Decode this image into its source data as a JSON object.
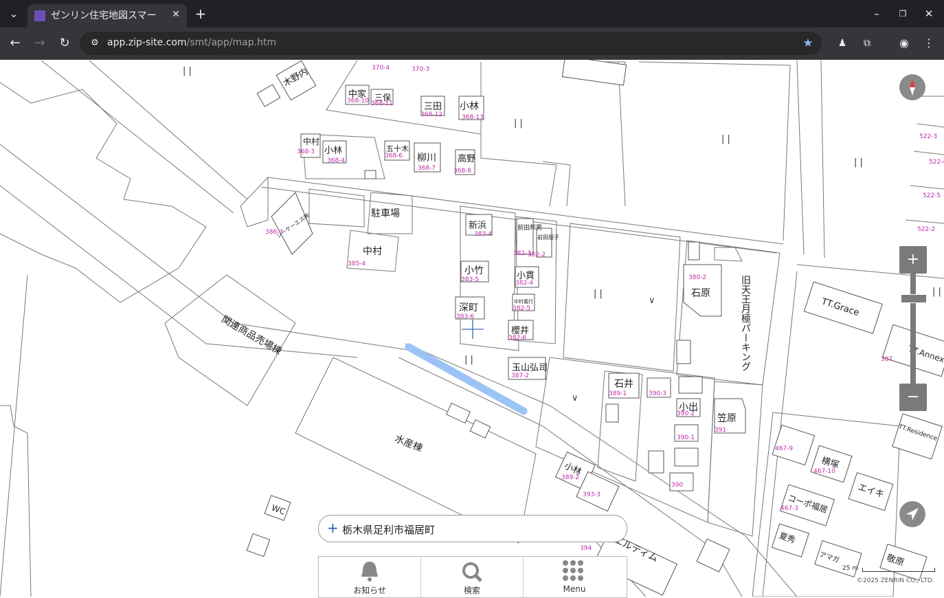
{
  "browser": {
    "tab_title": "ゼンリン住宅地図スマー",
    "url_host": "app.zip-site.com",
    "url_path": "/smt/app/map.htm"
  },
  "map": {
    "search_address": "栃木県足利市福居町",
    "menu": [
      {
        "label": "お知らせ",
        "icon": "bell-icon"
      },
      {
        "label": "検索",
        "icon": "search-icon"
      },
      {
        "label": "Menu",
        "icon": "grid-icon"
      }
    ],
    "zoom_in": "+",
    "zoom_out": "−",
    "scale_text": "25 m",
    "copyright": "©2025 ZENRIN CO., LTD.",
    "labels": {
      "kino": "木野内",
      "nakaya": "中家",
      "sanpo": "三保",
      "mita": "三田",
      "kobayashi1": "小林",
      "nakamura1": "中村",
      "kobayashi2": "小林",
      "isoju": "五十木",
      "yanagawa": "柳川",
      "takano": "高野",
      "parking": "駐車場",
      "shinhama": "新浜",
      "maeda1": "前田邦男",
      "maeda2": "前田朋子",
      "nakamura2": "中村",
      "kotake": "小竹",
      "konuki": "小貫",
      "fukamachi": "深町",
      "nakamura3": "中村義行",
      "sakurai": "櫻井",
      "tamayama": "玉山弘司",
      "ishii": "石井",
      "koide": "小出",
      "kasahara": "笠原",
      "ishihara": "石原",
      "old_parking": "旧天王月極パーキング",
      "kanren": "関連商品売場棟",
      "suisan": "水産棟",
      "wc": "WC",
      "kobayashi3": "小林",
      "eltim": "エルティム",
      "ttgrace": "TT.Grace",
      "ttannex": "TT.Annex",
      "ttres": "TT.Residence",
      "yokozuka": "横塚",
      "eiki": "エイキ",
      "kopo": "コーポ福居",
      "natsume": "夏秀",
      "amaga": "アマガ",
      "kyohara": "敬原",
      "sk": "シーケーエス㈱"
    },
    "numbers": {
      "n1": "370-4",
      "n2": "370-3",
      "n3": "368-10",
      "n4": "368-11",
      "n5": "368-12",
      "n6": "368-13",
      "n7": "368-3",
      "n8": "368-4",
      "n9": "368-6",
      "n10": "368-7",
      "n11": "368-8",
      "n12": "386-3",
      "n13": "385-4",
      "n14": "383-4",
      "n15": "382-3",
      "n16": "382-2",
      "n17": "383-5",
      "n18": "382-4",
      "n19": "383-6",
      "n20": "382-5",
      "n21": "382-6",
      "n22": "387-2",
      "n23": "389-1",
      "n24": "390-3",
      "n25": "390-2",
      "n26": "391",
      "n27": "380-2",
      "n28": "387",
      "n29": "389-2",
      "n30": "393-3",
      "n31": "394",
      "n32": "467-9",
      "n33": "467-10",
      "n34": "467-3",
      "n35": "522-3",
      "n36": "522-5",
      "n37": "522-4",
      "n38": "522-2",
      "n39": "390-1",
      "n40": "390"
    }
  }
}
